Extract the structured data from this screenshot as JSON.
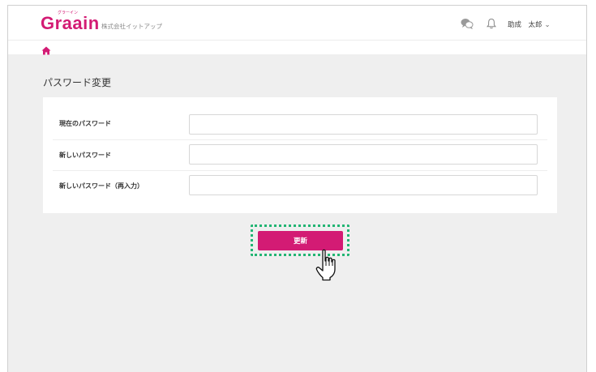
{
  "header": {
    "logo": "Graain",
    "logo_ruby": "グラーイン",
    "company": "株式会社イットアップ",
    "icons": [
      "chat-icon",
      "bell-icon"
    ],
    "user_name": "助成　太郎",
    "user_menu_chevron": "⌄"
  },
  "breadcrumb": {
    "icon": "home-icon"
  },
  "page": {
    "title": "パスワード変更"
  },
  "form": {
    "fields": [
      {
        "label": "現在のパスワード",
        "value": ""
      },
      {
        "label": "新しいパスワード",
        "value": ""
      },
      {
        "label": "新しいパスワード（再入力）",
        "value": ""
      }
    ],
    "submit_label": "更新"
  },
  "colors": {
    "brand": "#d31b74",
    "highlight": "#22b573",
    "page_bg": "#efefef"
  }
}
